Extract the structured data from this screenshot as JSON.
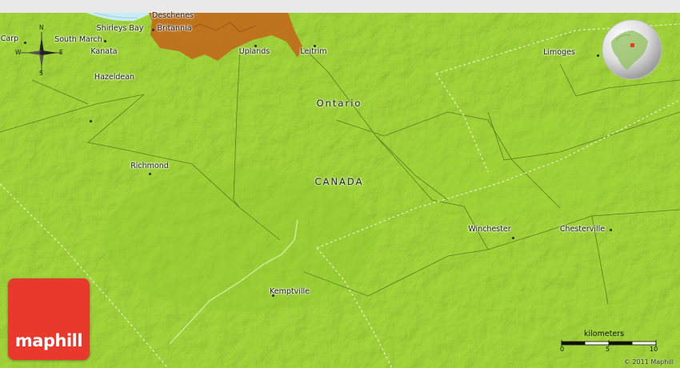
{
  "places": {
    "carp": "Carp",
    "south_march": "South March",
    "shirleys_bay": "Shirleys Bay",
    "deschenes": "Deschenes",
    "britannia": "Britannia",
    "kanata": "Kanata",
    "hazeldean": "Hazeldean",
    "uplands": "Uplands",
    "leitrim": "Leitrim",
    "limoges": "Limoges",
    "richmond": "Richmond",
    "winchester": "Winchester",
    "chesterville": "Chesterville",
    "kemptville": "Kemptville"
  },
  "regions": {
    "ontario": "Ontario",
    "canada": "CANADA"
  },
  "compass": {
    "n": "N",
    "s": "S",
    "e": "E",
    "w": "W"
  },
  "scale": {
    "title": "kilometers",
    "ticks": [
      "0",
      "5",
      "10"
    ]
  },
  "logo": {
    "text": "maphill"
  },
  "copyright": "© 2011 Maphill",
  "colors": {
    "land": "#a6da3c",
    "land_dark": "#8fc62c",
    "urban": "#c06a1a",
    "water": "#c8ecf6",
    "logo_red": "#e8392c"
  },
  "icons": {
    "compass": "compass-rose-icon",
    "globe": "locator-globe-icon"
  }
}
